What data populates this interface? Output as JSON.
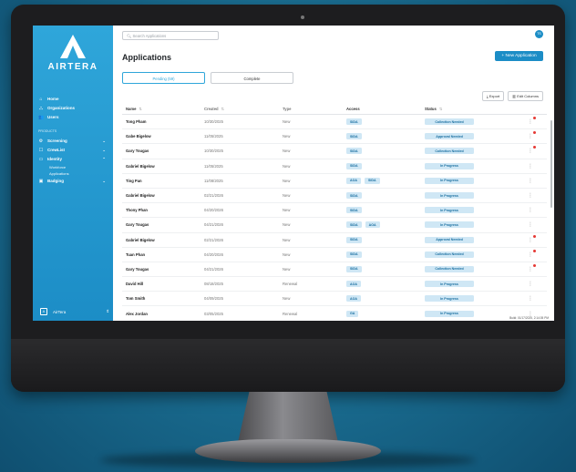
{
  "app": {
    "logo_text": "AIRTERA"
  },
  "sidebar": {
    "nav": [
      {
        "label": "Home",
        "icon": "home-icon"
      },
      {
        "label": "Organizations",
        "icon": "org-icon"
      },
      {
        "label": "Users",
        "icon": "users-icon"
      }
    ],
    "section_label": "PRODUCTS",
    "products": [
      {
        "label": "Screening",
        "icon": "screening-icon",
        "expanded": false
      },
      {
        "label": "CrewList",
        "icon": "crewlist-icon",
        "expanded": false
      },
      {
        "label": "Identity",
        "icon": "identity-icon",
        "expanded": true,
        "children": [
          "Workforce",
          "Applications"
        ]
      },
      {
        "label": "Badging",
        "icon": "badging-icon",
        "expanded": false
      }
    ],
    "footer_label": "AirTera"
  },
  "header": {
    "search_placeholder": "Search Applications",
    "avatar_initials": "TS"
  },
  "page": {
    "title": "Applications",
    "new_button": "+ New Application",
    "tabs": [
      {
        "label": "Pending (59)",
        "active": true
      },
      {
        "label": "Complete",
        "active": false
      }
    ],
    "export_label": "Export",
    "edit_columns_label": "Edit Columns"
  },
  "table": {
    "columns": [
      "Name",
      "Created",
      "Type",
      "Access",
      "Status"
    ],
    "rows": [
      {
        "name": "Tong Pham",
        "created": "10/30/2025",
        "type": "New",
        "access": [
          "SIDA"
        ],
        "status": "Collection Needed",
        "alert": true
      },
      {
        "name": "Gabe Bigelow",
        "created": "11/05/2025",
        "type": "New",
        "access": [
          "SIDA"
        ],
        "status": "Approval Needed",
        "alert": true
      },
      {
        "name": "Gary Tougas",
        "created": "10/30/2025",
        "type": "New",
        "access": [
          "SIDA"
        ],
        "status": "Collection Needed",
        "alert": true
      },
      {
        "name": "Gabriel Bigelow",
        "created": "11/05/2025",
        "type": "New",
        "access": [
          "SIDA"
        ],
        "status": "In Progress",
        "alert": false
      },
      {
        "name": "Ting Pan",
        "created": "11/08/2025",
        "type": "New",
        "access": [
          "AOA",
          "SIDA"
        ],
        "status": "In Progress",
        "alert": false
      },
      {
        "name": "Gabriel Bigelow",
        "created": "02/21/2026",
        "type": "New",
        "access": [
          "SIDA"
        ],
        "status": "In Progress",
        "alert": false
      },
      {
        "name": "Thony Phan",
        "created": "04/20/2026",
        "type": "New",
        "access": [
          "SIDA"
        ],
        "status": "In Progress",
        "alert": false
      },
      {
        "name": "Gary Tougas",
        "created": "04/21/2026",
        "type": "New",
        "access": [
          "SIDA",
          "AOA"
        ],
        "status": "In Progress",
        "alert": false
      },
      {
        "name": "Gabriel Bigelow",
        "created": "02/21/2026",
        "type": "New",
        "access": [
          "SIDA"
        ],
        "status": "Approval Needed",
        "alert": true
      },
      {
        "name": "Tuan Phan",
        "created": "04/20/2026",
        "type": "New",
        "access": [
          "SIDA"
        ],
        "status": "Collection Needed",
        "alert": true
      },
      {
        "name": "Gary Tougas",
        "created": "04/21/2026",
        "type": "New",
        "access": [
          "SIDA"
        ],
        "status": "Collection Needed",
        "alert": true
      },
      {
        "name": "David Hill",
        "created": "08/18/2025",
        "type": "Renewal",
        "access": [
          "AOA"
        ],
        "status": "In Progress",
        "alert": false
      },
      {
        "name": "Tom Smith",
        "created": "04/09/2025",
        "type": "New",
        "access": [
          "AOA"
        ],
        "status": "In Progress",
        "alert": false
      },
      {
        "name": "Alex Jordan",
        "created": "03/05/2025",
        "type": "Renewal",
        "access": [
          "GA"
        ],
        "status": "In Progress",
        "alert": false
      }
    ]
  },
  "footer": {
    "build": "Build: 01/17/2025, 2:14:05 PM"
  }
}
